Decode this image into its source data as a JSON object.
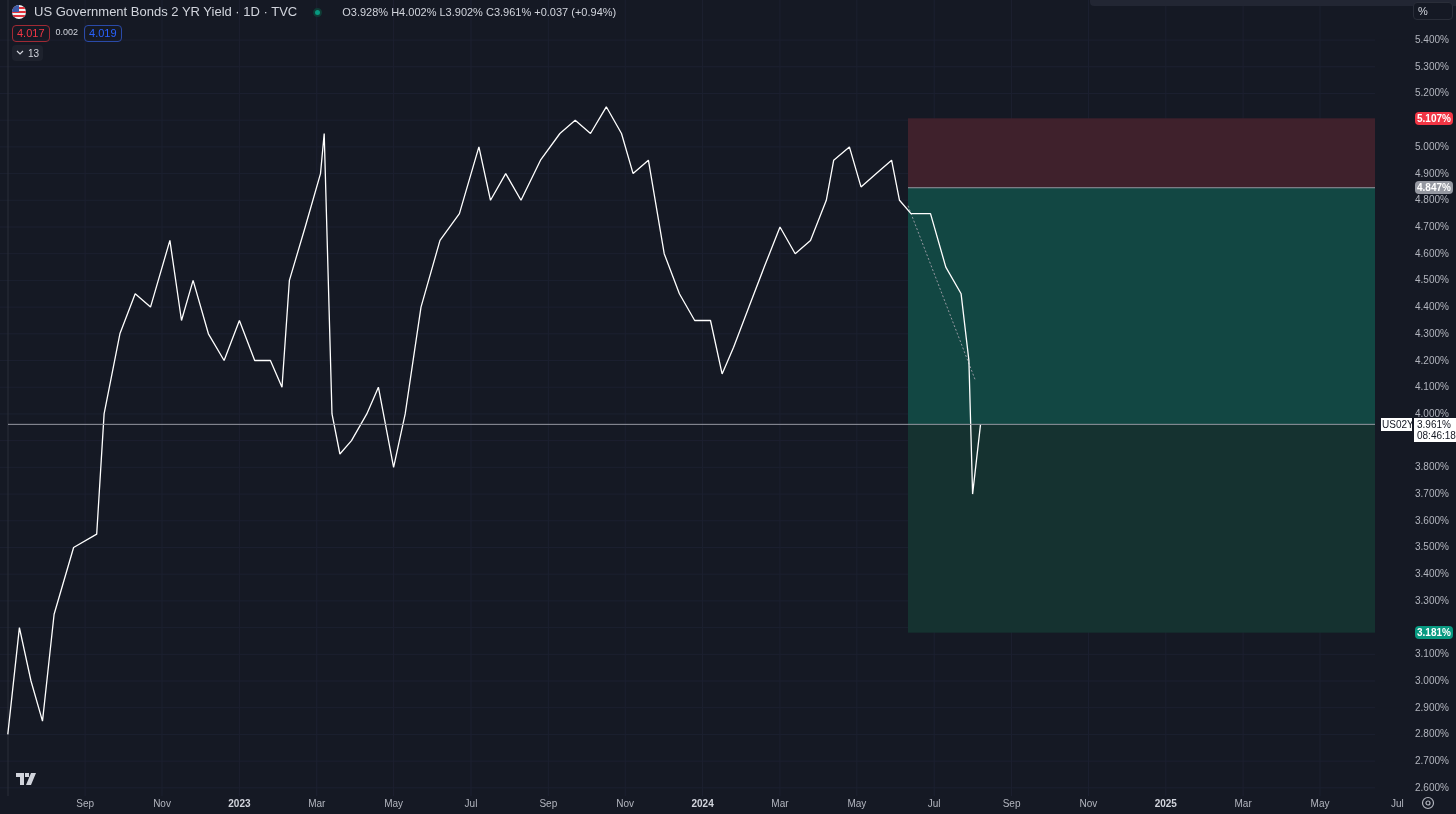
{
  "legend": {
    "title": "US Government Bonds 2 YR Yield · 1D · TVC",
    "market_open": true,
    "ohlc": "O3.928% H4.002% L3.902% C3.961% +0.037 (+0.94%)"
  },
  "quote": {
    "bid": "4.017",
    "spread": "0.002",
    "ask": "4.019"
  },
  "indicators": {
    "count": "13",
    "expanded": false
  },
  "axis_unit": "%",
  "chart_data": {
    "type": "line",
    "xlim": [
      2022.5,
      2025.625
    ],
    "ylim": [
      2.502,
      5.55
    ],
    "grid": true,
    "ref_lines": [
      {
        "axis": "y",
        "value": 3.961,
        "color": "#9598a1"
      }
    ],
    "xticks": [
      {
        "value": 2022.667,
        "label": "Sep"
      },
      {
        "value": 2022.833,
        "label": "Nov"
      },
      {
        "value": 2023,
        "label": "2023"
      },
      {
        "value": 2023.167,
        "label": "Mar"
      },
      {
        "value": 2023.333,
        "label": "May"
      },
      {
        "value": 2023.5,
        "label": "Jul"
      },
      {
        "value": 2023.667,
        "label": "Sep"
      },
      {
        "value": 2023.833,
        "label": "Nov"
      },
      {
        "value": 2024,
        "label": "2024"
      },
      {
        "value": 2024.167,
        "label": "Mar"
      },
      {
        "value": 2024.333,
        "label": "May"
      },
      {
        "value": 2024.5,
        "label": "Jul"
      },
      {
        "value": 2024.667,
        "label": "Sep"
      },
      {
        "value": 2024.833,
        "label": "Nov"
      },
      {
        "value": 2025,
        "label": "2025"
      },
      {
        "value": 2025.167,
        "label": "Mar"
      },
      {
        "value": 2025.333,
        "label": "May"
      },
      {
        "value": 2025.5,
        "label": "Jul"
      }
    ],
    "yticks": [
      {
        "value": 5.4,
        "label": "5.400%"
      },
      {
        "value": 5.3,
        "label": "5.300%"
      },
      {
        "value": 5.2,
        "label": "5.200%"
      },
      {
        "value": 5.0,
        "label": "5.000%"
      },
      {
        "value": 4.9,
        "label": "4.900%"
      },
      {
        "value": 4.8,
        "label": "4.800%"
      },
      {
        "value": 4.7,
        "label": "4.700%"
      },
      {
        "value": 4.6,
        "label": "4.600%"
      },
      {
        "value": 4.5,
        "label": "4.500%"
      },
      {
        "value": 4.4,
        "label": "4.400%"
      },
      {
        "value": 4.3,
        "label": "4.300%"
      },
      {
        "value": 4.2,
        "label": "4.200%"
      },
      {
        "value": 4.1,
        "label": "4.100%"
      },
      {
        "value": 4.0,
        "label": "4.000%"
      },
      {
        "value": 3.8,
        "label": "3.800%"
      },
      {
        "value": 3.7,
        "label": "3.700%"
      },
      {
        "value": 3.6,
        "label": "3.600%"
      },
      {
        "value": 3.5,
        "label": "3.500%"
      },
      {
        "value": 3.4,
        "label": "3.400%"
      },
      {
        "value": 3.3,
        "label": "3.300%"
      },
      {
        "value": 3.1,
        "label": "3.100%"
      },
      {
        "value": 3.0,
        "label": "3.000%"
      },
      {
        "value": 2.9,
        "label": "2.900%"
      },
      {
        "value": 2.8,
        "label": "2.800%"
      },
      {
        "value": 2.7,
        "label": "2.700%"
      },
      {
        "value": 2.6,
        "label": "2.600%"
      }
    ],
    "x": [
      2022.5,
      2022.525,
      2022.55,
      2022.575,
      2022.6,
      2022.642,
      2022.692,
      2022.708,
      2022.742,
      2022.775,
      2022.808,
      2022.85,
      2022.875,
      2022.9,
      2022.933,
      2022.967,
      2023.0,
      2023.033,
      2023.067,
      2023.092,
      2023.108,
      2023.142,
      2023.175,
      2023.183,
      2023.2,
      2023.217,
      2023.242,
      2023.275,
      2023.3,
      2023.333,
      2023.358,
      2023.392,
      2023.433,
      2023.475,
      2023.517,
      2023.542,
      2023.575,
      2023.608,
      2023.65,
      2023.692,
      2023.725,
      2023.758,
      2023.792,
      2023.825,
      2023.85,
      2023.883,
      2023.917,
      2023.95,
      2023.983,
      2024.017,
      2024.042,
      2024.067,
      2024.1,
      2024.133,
      2024.167,
      2024.2,
      2024.233,
      2024.267,
      2024.283,
      2024.317,
      2024.342,
      2024.375,
      2024.408,
      2024.425,
      2024.45,
      2024.492,
      2024.525,
      2024.558,
      2024.575,
      2024.583,
      2024.6
    ],
    "series": [
      {
        "color": "#ffffff",
        "values": [
          2.8,
          3.2,
          3.0,
          2.85,
          3.25,
          3.5,
          3.55,
          4.0,
          4.3,
          4.45,
          4.4,
          4.65,
          4.35,
          4.5,
          4.3,
          4.2,
          4.35,
          4.2,
          4.2,
          4.1,
          4.5,
          4.7,
          4.9,
          5.05,
          4.0,
          3.85,
          3.9,
          4.0,
          4.1,
          3.8,
          4.0,
          4.4,
          4.65,
          4.75,
          5.0,
          4.8,
          4.9,
          4.8,
          4.95,
          5.05,
          5.1,
          5.05,
          5.15,
          5.05,
          4.9,
          4.95,
          4.6,
          4.45,
          4.35,
          4.35,
          4.15,
          4.25,
          4.4,
          4.55,
          4.7,
          4.6,
          4.65,
          4.8,
          4.95,
          5.0,
          4.85,
          4.9,
          4.95,
          4.8,
          4.75,
          4.75,
          4.55,
          4.45,
          4.2,
          3.7,
          3.96
        ]
      }
    ]
  },
  "position": {
    "stop": "5.107%",
    "entry": "4.847%",
    "target": "3.181%"
  },
  "last_price": {
    "symbol": "US02Y",
    "price": "3.961%",
    "countdown": "08:46:18"
  }
}
